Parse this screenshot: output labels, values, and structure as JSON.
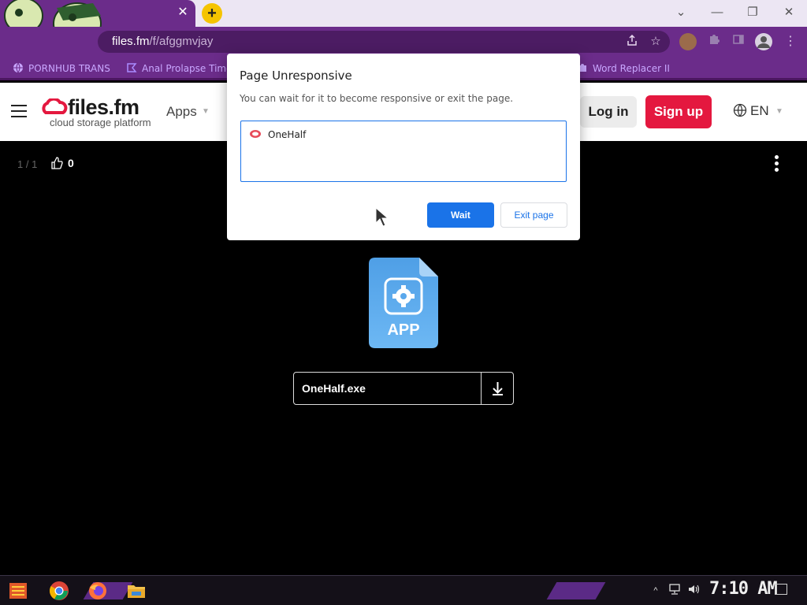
{
  "browser": {
    "tab": {
      "close_glyph": "✕"
    },
    "new_tab_glyph": "+",
    "window_controls": [
      "⌄",
      "—",
      "❐",
      "✕"
    ],
    "url": {
      "host": "files.fm",
      "path": "/f/afggmvjay"
    },
    "bookmarks": [
      {
        "label": "PORNHUB TRANS",
        "icon": "globe-icon"
      },
      {
        "label": "Anal Prolapse Time",
        "icon": "bookmark-tag-icon"
      },
      {
        "label": "Word Replacer II",
        "icon": "puzzle-icon"
      }
    ],
    "accent": "#6b2c8a"
  },
  "site": {
    "logo_name": "files.fm",
    "logo_tagline": "cloud storage platform",
    "apps_label": "Apps",
    "login_label": "Log in",
    "signup_label": "Sign up",
    "language": "EN",
    "signup_color": "#e4183f"
  },
  "viewer": {
    "counter": "1 / 1",
    "likes": "0",
    "file_type_label": "APP",
    "file_name": "OneHalf.exe"
  },
  "dialog": {
    "title": "Page Unresponsive",
    "message": "You can wait for it to become responsive or exit the page.",
    "pages": [
      "OneHalf"
    ],
    "wait_label": "Wait",
    "exit_label": "Exit page",
    "primary_color": "#1a73e8"
  },
  "taskbar": {
    "clock": "7:10 AM",
    "apps": [
      "start-icon",
      "chrome-icon",
      "firefox-icon",
      "file-explorer-icon"
    ]
  }
}
